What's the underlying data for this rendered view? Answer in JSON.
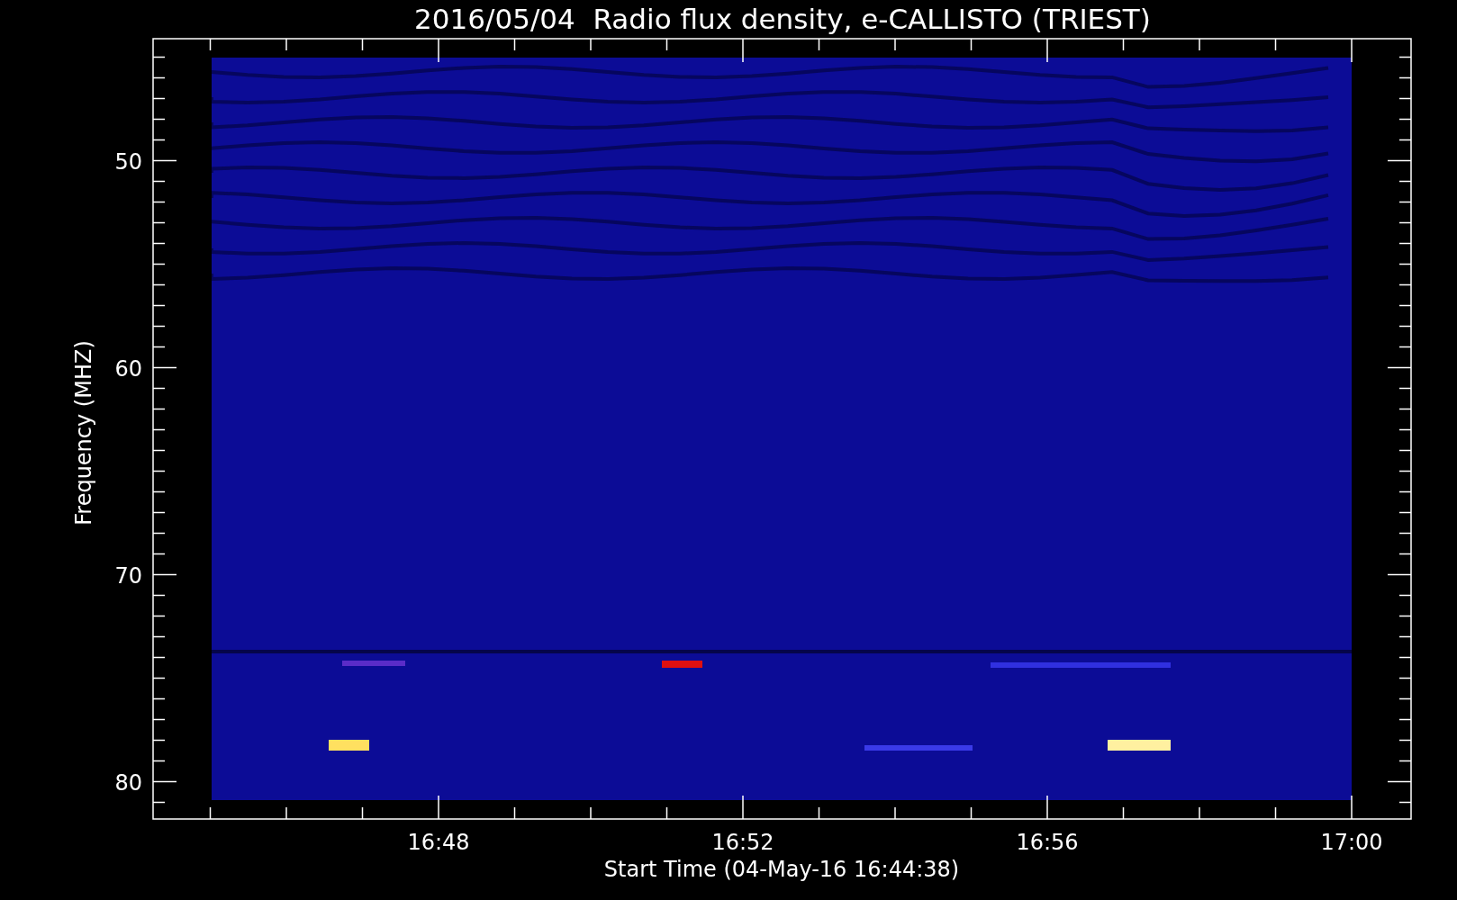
{
  "title": "2016/05/04  Radio flux density, e-CALLISTO (TRIEST)",
  "plot": {
    "ylabel": "Frequency (MHZ)",
    "xlabel": "Start Time (04-May-16 16:44:38)",
    "yticks": [
      "50",
      "60",
      "70",
      "80"
    ],
    "xticks": [
      "16:48",
      "16:52",
      "16:56",
      "17:00"
    ]
  }
}
